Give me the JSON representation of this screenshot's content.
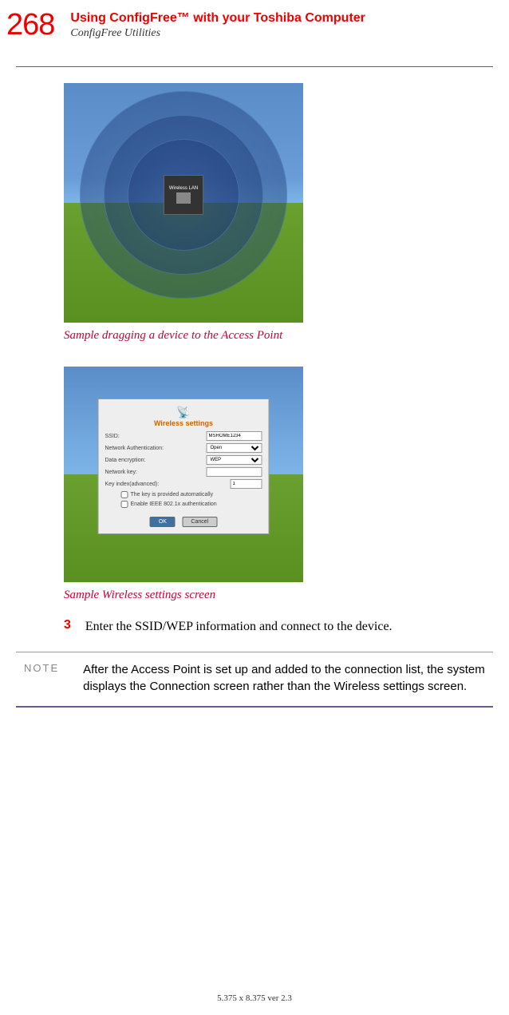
{
  "header": {
    "page_number": "268",
    "title": "Using ConfigFree™ with your Toshiba Computer",
    "subtitle": "ConfigFree Utilities"
  },
  "screenshot1": {
    "caption": "Sample dragging a device to the Access Point",
    "center_label": "Wireless LAN"
  },
  "screenshot2": {
    "caption": "Sample Wireless settings screen",
    "dialog": {
      "title": "Wireless settings",
      "ssid_label": "SSID:",
      "ssid_value": "MSHOME1234",
      "auth_label": "Network Authentication:",
      "auth_value": "Open",
      "encrypt_label": "Data encryption:",
      "encrypt_value": "WEP",
      "key_label": "Network key:",
      "key_index_label": "Key index(advanced):",
      "key_index_value": "1",
      "checkbox1": "The key is provided automatically",
      "checkbox2": "Enable IEEE 802.1x authentication",
      "ok_btn": "OK",
      "cancel_btn": "Cancel"
    }
  },
  "step": {
    "number": "3",
    "text": "Enter the SSID/WEP information and connect to the device."
  },
  "note": {
    "label": "NOTE",
    "text": "After the Access Point is set up and added to the connection list, the system displays the Connection screen rather than the Wireless settings screen."
  },
  "footer": "5.375 x 8.375 ver 2.3"
}
